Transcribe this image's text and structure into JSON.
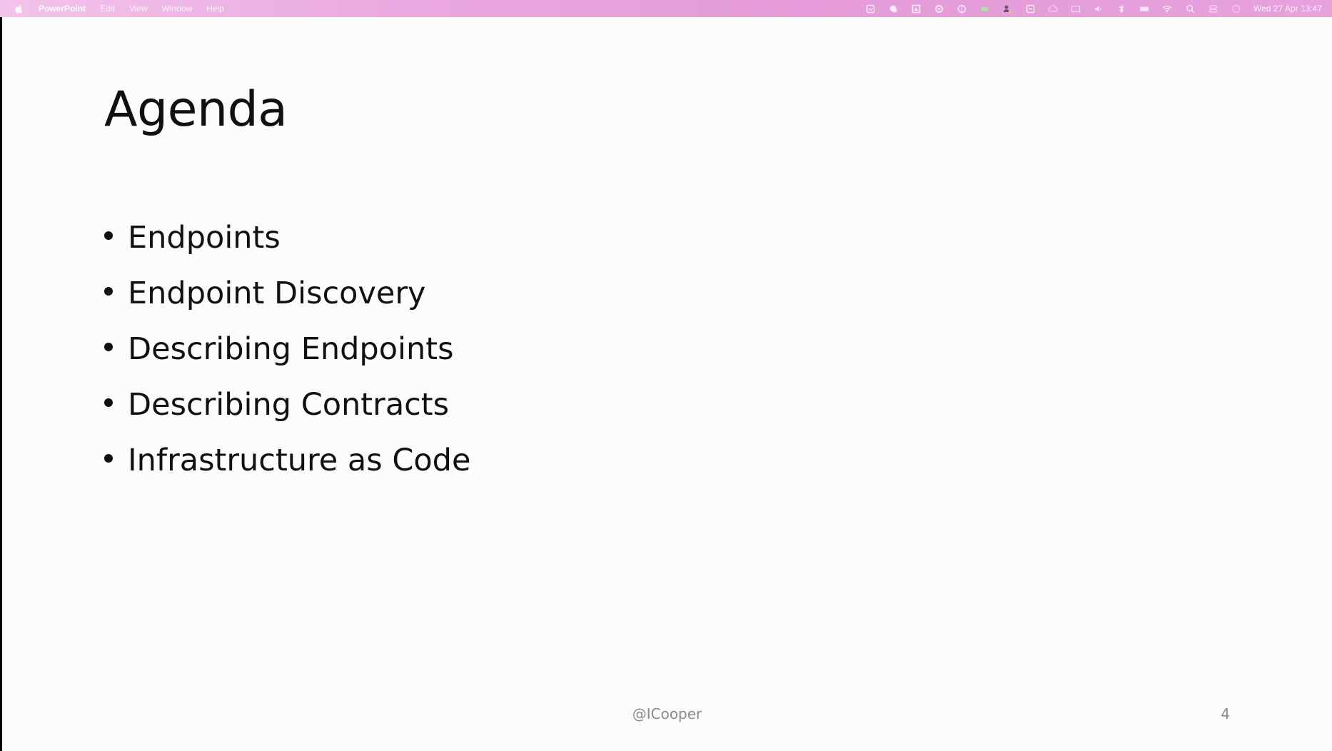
{
  "menubar": {
    "app_name": "PowerPoint",
    "items": [
      "Edit",
      "View",
      "Window",
      "Help"
    ],
    "status_icons": [
      "mail-icon",
      "chat-icon",
      "drive-icon",
      "settings-icon",
      "vpn-icon",
      "battery-icon",
      "user-icon",
      "screen-icon",
      "cloud-icon",
      "display-icon",
      "volume-icon",
      "bluetooth-icon",
      "keyboard-icon",
      "wifi-icon",
      "search-icon",
      "control-center-icon",
      "siri-icon"
    ],
    "clock": "Wed 27 Apr 13:47",
    "background_color": "#e8a6df"
  },
  "slide": {
    "title": "Agenda",
    "bullets": [
      "Endpoints",
      "Endpoint Discovery",
      "Describing Endpoints",
      "Describing Contracts",
      "Infrastructure as Code"
    ],
    "footer": "@ICooper",
    "page_number": "4"
  }
}
